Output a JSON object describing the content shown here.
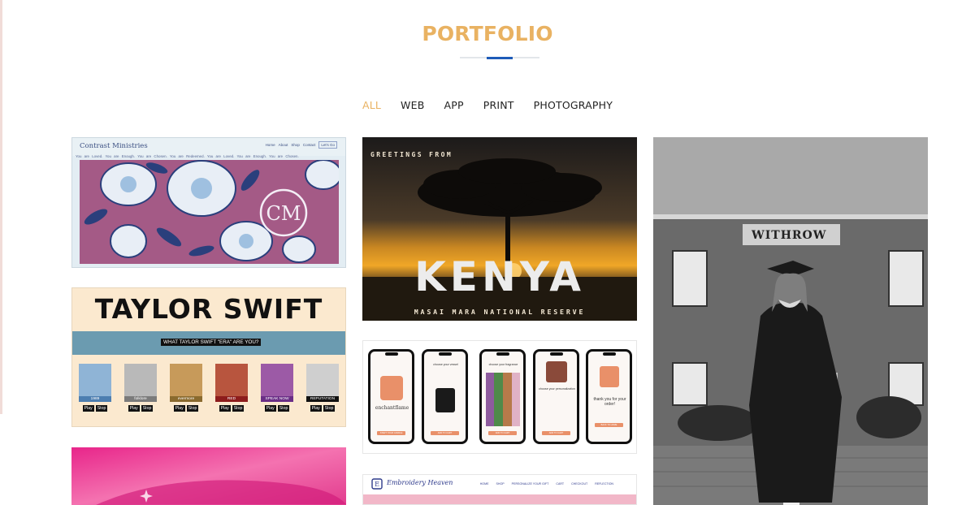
{
  "page": {
    "title": "PORTFOLIO",
    "accent_color": "#e9b262",
    "rule_accent_color": "#1e5bb8"
  },
  "filters": [
    {
      "label": "ALL",
      "active": true
    },
    {
      "label": "WEB",
      "active": false
    },
    {
      "label": "APP",
      "active": false
    },
    {
      "label": "PRINT",
      "active": false
    },
    {
      "label": "PHOTOGRAPHY",
      "active": false
    }
  ],
  "items": {
    "contrast": {
      "brand": "Contrast Ministries",
      "nav": [
        "Home",
        "About",
        "Shop",
        "Contact"
      ],
      "nav_button": "Let's Go",
      "ticker": "You are Loved.   You are Enough.   You are Chosen.   You are Redeemed.   You are Loved.   You are Enough.   You are Chosen."
    },
    "kenya": {
      "top_text": "GREETINGS FROM",
      "headline": "KENYA",
      "bottom_text": "MASAI MARA NATIONAL RESERVE"
    },
    "graduate": {
      "building_sign": "WITHROW"
    },
    "taylor": {
      "headline": "TAYLOR SWIFT",
      "band_text": "WHAT TAYLOR SWIFT \"ERA\" ARE YOU?",
      "albums": [
        {
          "title": "1989",
          "play": "Play",
          "stop": "Stop",
          "color": "#8fb4d6",
          "label_bg": "#4d7eb0"
        },
        {
          "title": "folklore",
          "play": "Play",
          "stop": "Stop",
          "color": "#b9b9b9",
          "label_bg": "#7b7b7b"
        },
        {
          "title": "evermore",
          "play": "Play",
          "stop": "Stop",
          "color": "#c79a5a",
          "label_bg": "#8a6a2e"
        },
        {
          "title": "RED",
          "play": "Play",
          "stop": "Stop",
          "color": "#b8553e",
          "label_bg": "#8d1c1c"
        },
        {
          "title": "SPEAK NOW",
          "play": "Play",
          "stop": "Stop",
          "color": "#9c5aa6",
          "label_bg": "#6a2e86"
        },
        {
          "title": "REPUTATION",
          "play": "Play",
          "stop": "Stop",
          "color": "#cfcfcf",
          "label_bg": "#111111"
        }
      ]
    },
    "app": {
      "screens": [
        {
          "text": "enchantflame",
          "button": "START YOUR CANDLE"
        },
        {
          "text": "choose your vessel",
          "button": "ADD TO CART"
        },
        {
          "text": "choose your fragrance",
          "button": "ADD TO CART"
        },
        {
          "text": "choose your personalization",
          "button": "ADD TO CART"
        },
        {
          "text": "thank you for your order!",
          "button": "BACK TO HOME"
        }
      ]
    },
    "embroidery": {
      "brand": "Embroidery Heaven",
      "nav": [
        "HOME",
        "SHOP",
        "PERSONALIZE YOUR GIFT",
        "CART",
        "CHECKOUT",
        "REFLECTION"
      ]
    }
  }
}
